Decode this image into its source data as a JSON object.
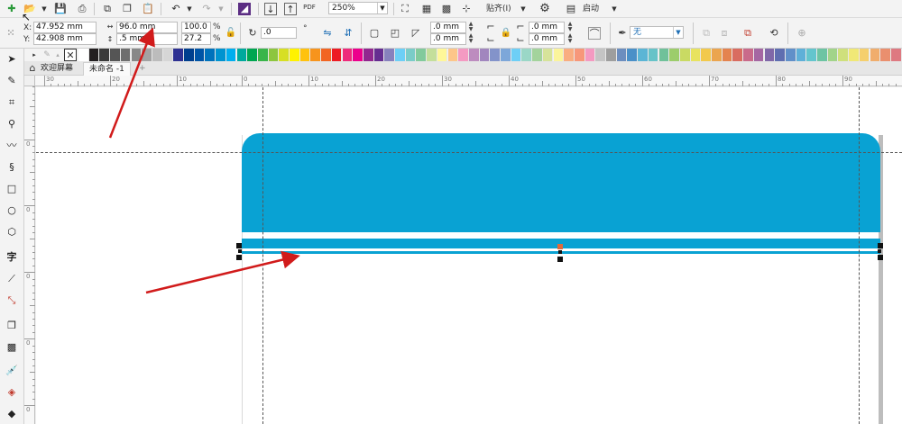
{
  "toolbar": {
    "zoom_value": "250%",
    "snap_label": "贴齐(I)",
    "launch_label": "启动",
    "pdf_label": "PDF"
  },
  "property_bar": {
    "x_label": "X:",
    "x_value": "47.952 mm",
    "y_label": "Y:",
    "y_value": "42.908 mm",
    "width_value": "96.0 mm",
    "height_value": ".5 mm",
    "scale_x": "100.0",
    "scale_y": "27.2",
    "percent": "%",
    "rotation_value": ".0",
    "degree": "°",
    "corner1": ".0 mm",
    "corner2": ".0 mm",
    "corner3": ".0 mm",
    "corner4": ".0 mm",
    "outline_value": "无"
  },
  "tabs": {
    "welcome": "欢迎屏幕",
    "document": "未命名 -1",
    "add": "+"
  },
  "ruler": {
    "h_labels": [
      "30",
      "20",
      "10",
      "0",
      "10",
      "20",
      "30",
      "40",
      "50",
      "60",
      "70",
      "80",
      "90"
    ],
    "v_labels": [
      "0",
      "0",
      "0",
      "0",
      "0",
      "0",
      "0",
      "0",
      "0"
    ]
  },
  "palette": [
    "#ffffff",
    "#231f20",
    "#3a3a3a",
    "#555555",
    "#6e6e6e",
    "#888888",
    "#a3a3a3",
    "#bcbcbc",
    "#d6d6d6",
    "#2e3192",
    "#003f8e",
    "#0054a6",
    "#0072bc",
    "#0093d0",
    "#00aeef",
    "#00a99d",
    "#00a651",
    "#39b54a",
    "#8dc63f",
    "#d7df23",
    "#fff200",
    "#ffc20e",
    "#f7941d",
    "#f26522",
    "#ed1c24",
    "#ee2a7b",
    "#ec008c",
    "#92278f",
    "#662d91",
    "#8781bd",
    "#6dcff6",
    "#7accc8",
    "#82ca9c",
    "#c4df9b",
    "#fff799",
    "#fdc689",
    "#f49ac2",
    "#bd8cbf",
    "#a186be",
    "#8393ca",
    "#7da7d9",
    "#6ecff6",
    "#9ad7c7",
    "#a3d39c",
    "#d6e39a",
    "#fbf49c",
    "#f9ad81",
    "#f7977a",
    "#f49ac1",
    "#c4c4c4",
    "#9e9e9e",
    "#6c8ebf",
    "#4a90c8",
    "#5bb5d5",
    "#67c3c8",
    "#70c19a",
    "#9ccd6b",
    "#c9da63",
    "#e8e35f",
    "#f2c94c",
    "#eba54f",
    "#e4834f",
    "#d96c60",
    "#c96a8a",
    "#a567a2",
    "#8068a8",
    "#5f6eb0",
    "#6190c9",
    "#5fb0d8",
    "#64c5cd",
    "#6dc4a3",
    "#a2d48a",
    "#cfe07c",
    "#f0e876",
    "#f5cf6d",
    "#f0ad6c",
    "#ea8f6e",
    "#de7981"
  ],
  "colors": {
    "accent_blue": "#09a2d3",
    "arrow_red": "#d11b1b"
  }
}
